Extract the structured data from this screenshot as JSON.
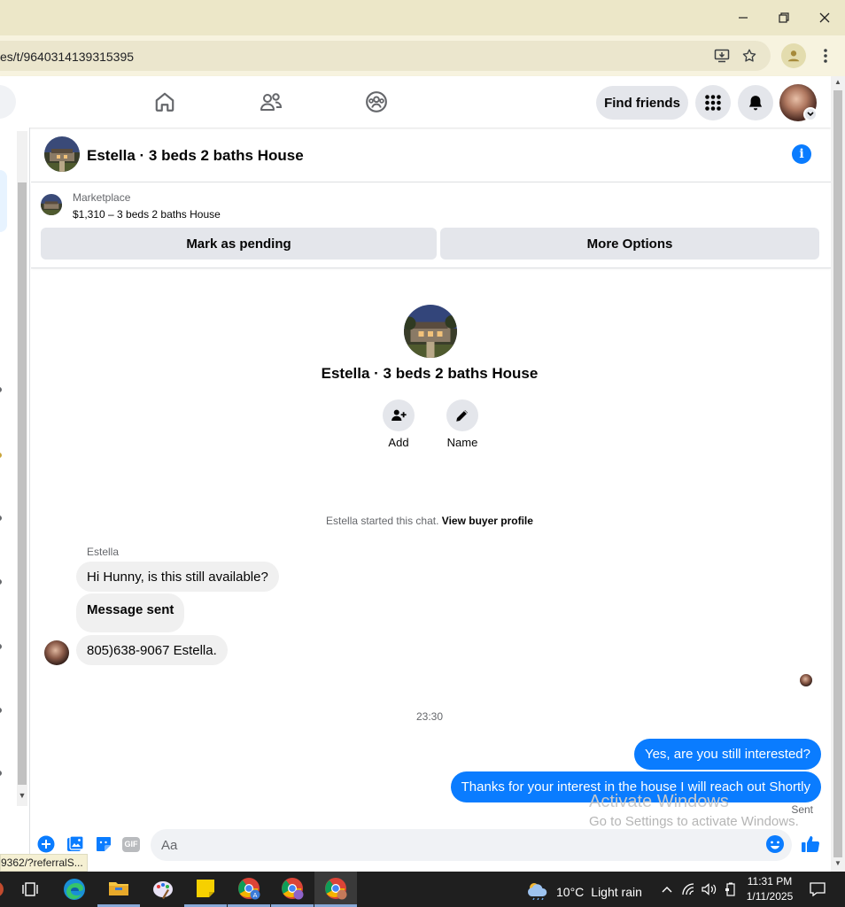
{
  "browser": {
    "url_fragment": "es/t/9640314139315395",
    "status_url": "9362/?referralS..."
  },
  "facebook": {
    "find_friends_label": "Find friends"
  },
  "chat": {
    "title": "Estella · 3 beds 2 baths House",
    "marketplace_label": "Marketplace",
    "listing": "$1,310 – 3 beds 2 baths House",
    "mark_pending_label": "Mark as pending",
    "more_options_label": "More Options",
    "profile_name": "Estella · 3 beds 2 baths House",
    "add_label": "Add",
    "name_label": "Name",
    "started_text": "Estella started this chat.",
    "view_buyer_label": "View buyer profile",
    "sender_name": "Estella",
    "messages_in": [
      "Hi Hunny, is this still available?",
      "Message sent",
      "805)638-9067 Estella."
    ],
    "timestamp": "23:30",
    "messages_out": [
      "Yes, are you still interested?",
      "Thanks for your interest in the house I will reach out Shortly"
    ],
    "sent_label": "Sent",
    "composer_placeholder": "Aa",
    "gif_label": "GIF"
  },
  "watermark": {
    "line1": "Activate Windows",
    "line2": "Go to Settings to activate Windows."
  },
  "taskbar": {
    "weather_temp": "10°C",
    "weather_desc": "Light rain",
    "time": "11:31 PM",
    "date": "1/11/2025"
  },
  "colors": {
    "messenger_blue": "#0a7cff",
    "bubble_gray": "#f0f0f0",
    "titlebar": "#ece7c8",
    "taskbar": "#1f1f1f"
  }
}
